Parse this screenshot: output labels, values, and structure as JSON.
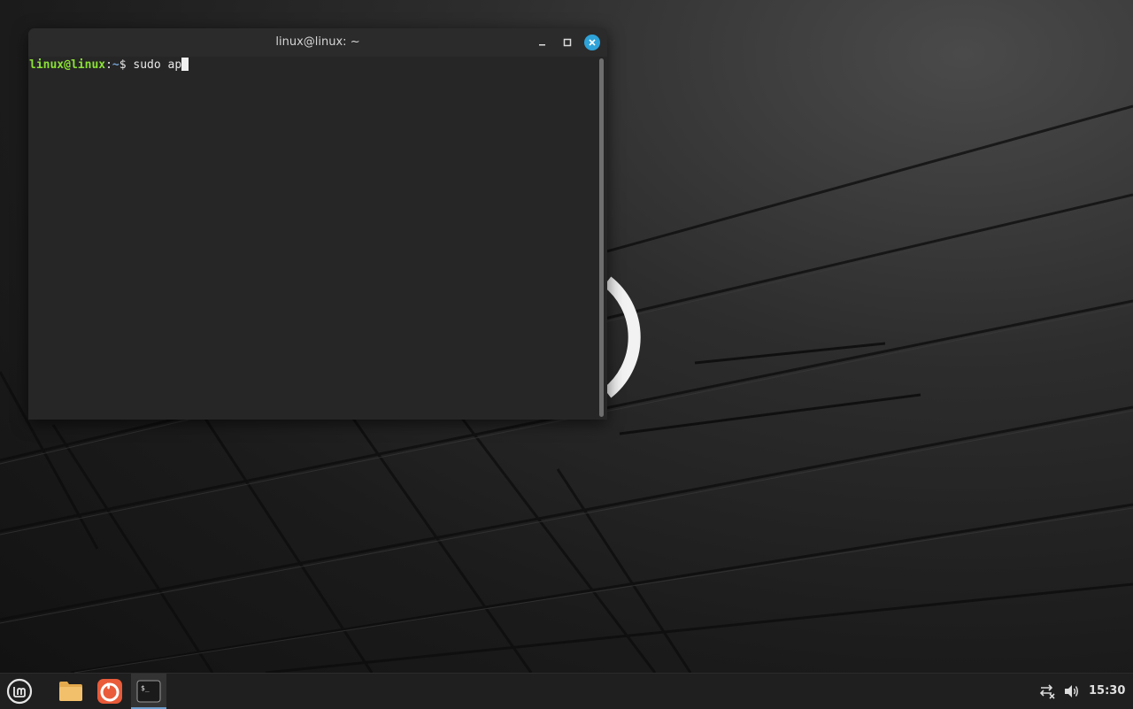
{
  "desktop": {
    "wallpaper": "dark-3d-tiles",
    "accent_color": "#2ea3d9"
  },
  "terminal": {
    "title": "linux@linux: ~",
    "prompt_user": "linux@linux",
    "prompt_colon": ":",
    "prompt_path": "~",
    "prompt_dollar": "$",
    "command": "sudo ap",
    "prompt_user_color": "#8ae234",
    "prompt_path_color": "#729fcf",
    "window_buttons": [
      "minimize-icon",
      "maximize-icon",
      "close-icon"
    ]
  },
  "taskbar": {
    "launchers": [
      "mint-menu-icon",
      "files-folder-icon",
      "firefox-icon",
      "terminal-icon"
    ],
    "tray": [
      "network-disconnected-icon",
      "volume-icon"
    ],
    "clock": "15:30"
  }
}
